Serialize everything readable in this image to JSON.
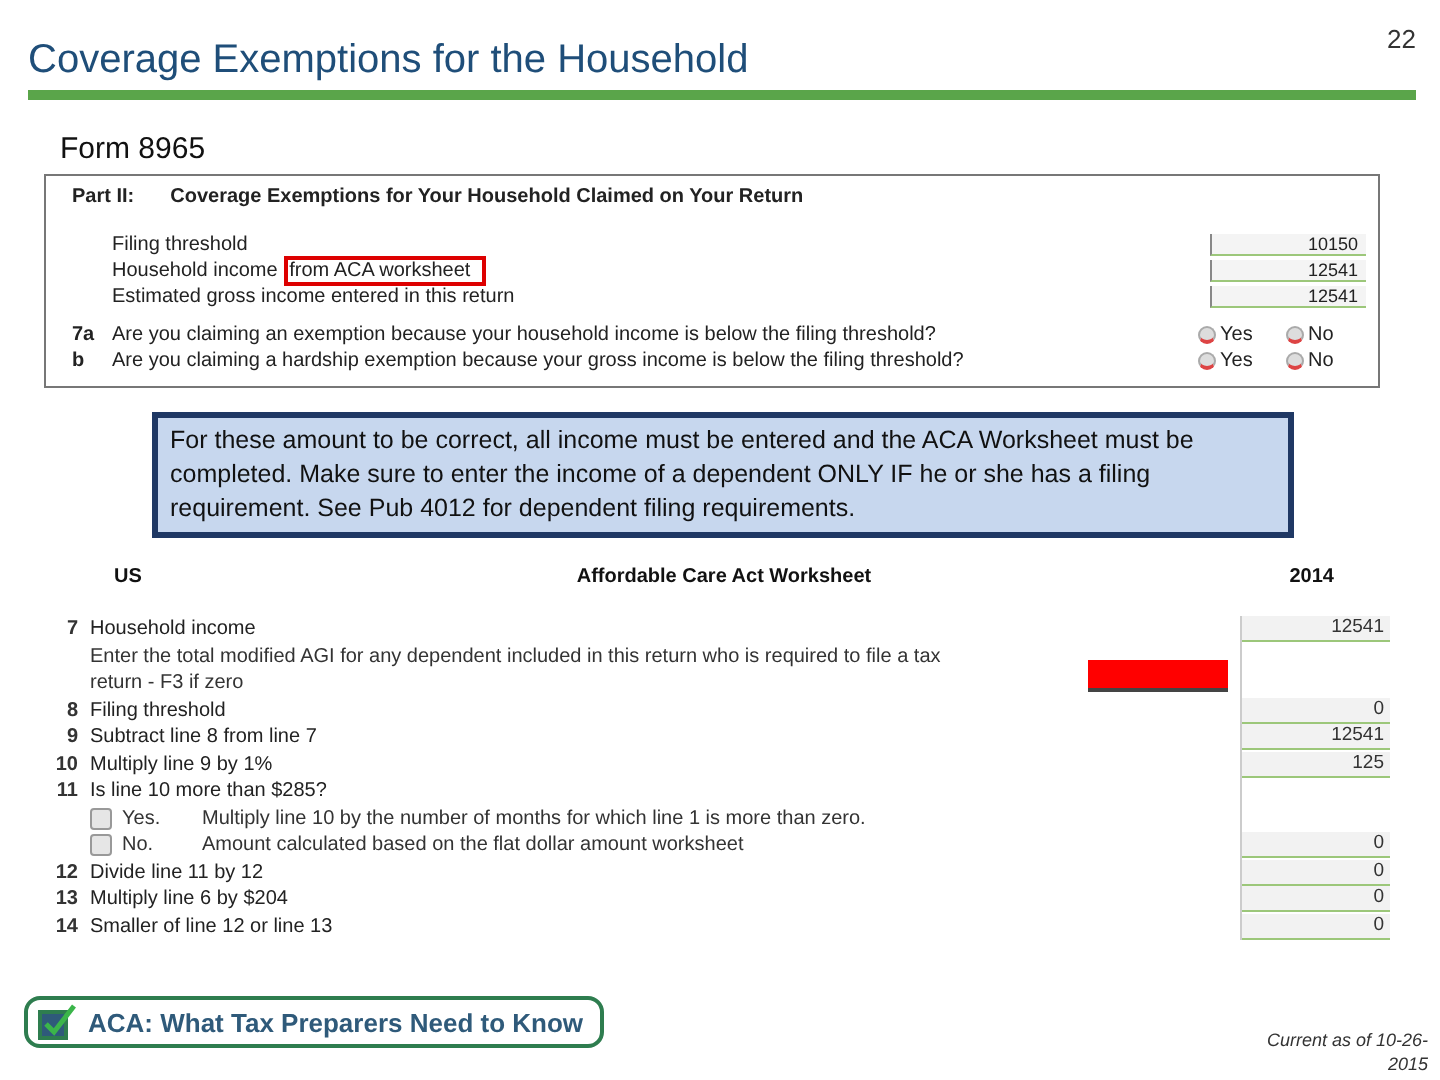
{
  "slide": {
    "title": "Coverage Exemptions for the Household",
    "page_number": "22"
  },
  "form_label": "Form 8965",
  "form_panel": {
    "part": "Part II:",
    "heading": "Coverage Exemptions for Your Household Claimed on Your Return",
    "amounts": [
      {
        "label": "Filing threshold",
        "value": "10150"
      },
      {
        "label": "Household income",
        "highlighted": "from ACA worksheet",
        "value": "12541"
      },
      {
        "label": "Estimated gross income entered in this return",
        "value": "12541"
      }
    ],
    "questions": [
      {
        "number": "7a",
        "text": "Are you claiming an exemption because your household income is below the filing threshold?",
        "options": [
          {
            "label": "Yes",
            "selected": false
          },
          {
            "label": "No",
            "selected": false
          }
        ]
      },
      {
        "number": "b",
        "text": "Are you claiming a hardship exemption because your gross income is below the filing threshold?",
        "options": [
          {
            "label": "Yes",
            "selected": false
          },
          {
            "label": "No",
            "selected": false
          }
        ]
      }
    ]
  },
  "callout": "For these amount to be correct, all income must be entered and the ACA Worksheet must be completed. Make sure to enter the income of a dependent ONLY IF he or she has a filing requirement. See Pub 4012 for dependent filing requirements.",
  "worksheet": {
    "region": "US",
    "title": "Affordable Care Act Worksheet",
    "year": "2014",
    "lines": [
      {
        "kind": "line",
        "number": "7",
        "text": "Household income",
        "value": "12541"
      },
      {
        "kind": "note",
        "text": "Enter the total modified AGI for any dependent included in this return who is required to file a tax return - F3 if zero",
        "marked": true
      },
      {
        "kind": "line",
        "number": "8",
        "text": "Filing threshold",
        "value": "0"
      },
      {
        "kind": "line",
        "number": "9",
        "text": "Subtract line 8 from line 7",
        "value": "12541"
      },
      {
        "kind": "line",
        "number": "10",
        "text": "Multiply line 9 by 1%",
        "value": "125"
      },
      {
        "kind": "line",
        "number": "11",
        "text": "Is line 10 more than $285?"
      },
      {
        "kind": "option",
        "label": "Yes.",
        "text": "Multiply line 10 by the number of months for which line 1 is more than zero.",
        "checked": false
      },
      {
        "kind": "option",
        "label": "No.",
        "text": "Amount calculated based on the flat dollar amount worksheet",
        "checked": false,
        "value": "0"
      },
      {
        "kind": "line",
        "number": "12",
        "text": "Divide line 11 by 12",
        "value": "0"
      },
      {
        "kind": "line",
        "number": "13",
        "text": "Multiply line 6 by $204",
        "value": "0"
      },
      {
        "kind": "line",
        "number": "14",
        "text": "Smaller of line 12 or line 13",
        "value": "0"
      }
    ]
  },
  "footer": {
    "logo_text": "ACA: What Tax Preparers Need to Know",
    "currency_note": "Current as of 10-26-2015"
  }
}
